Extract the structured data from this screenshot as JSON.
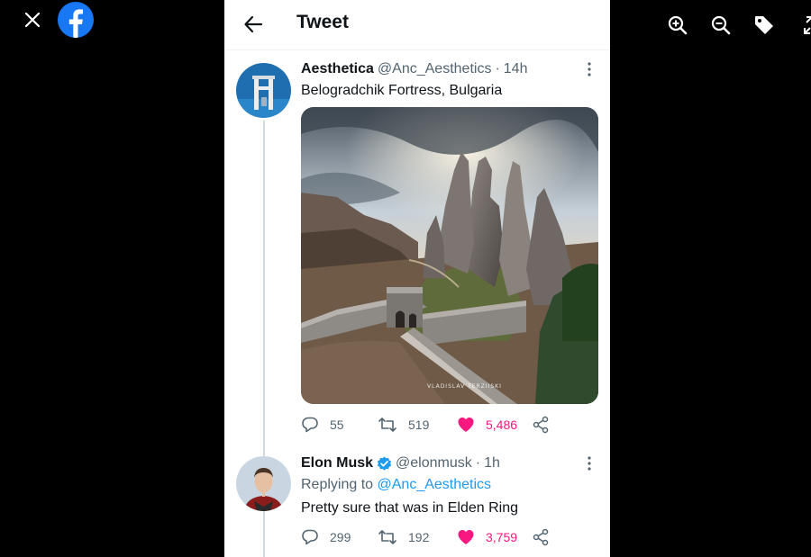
{
  "viewer": {
    "close_icon": "close-icon",
    "app_icon": "facebook-logo",
    "zoom_in_icon": "zoom-in-icon",
    "zoom_out_icon": "zoom-out-icon",
    "tag_icon": "tag-icon",
    "fullscreen_icon": "fullscreen-icon"
  },
  "header": {
    "title": "Tweet",
    "back_icon": "arrow-left-icon"
  },
  "tweets": [
    {
      "name": "Aesthetica",
      "handle": "@Anc_Aesthetics",
      "time": "14h",
      "text": "Belogradchik Fortress, Bulgaria",
      "image_watermark": "VLADISLAV TERZIISKI",
      "stats": {
        "replies": "55",
        "retweets": "519",
        "likes": "5,486"
      },
      "liked": true
    },
    {
      "name": "Elon Musk",
      "verified": true,
      "handle": "@elonmusk",
      "time": "1h",
      "replying_label": "Replying to",
      "replying_to": "@Anc_Aesthetics",
      "text": "Pretty sure that was in Elden Ring",
      "stats": {
        "replies": "299",
        "retweets": "192",
        "likes": "3,759"
      },
      "liked": true
    }
  ],
  "colors": {
    "accent": "#1d9bf0",
    "like": "#f91880",
    "secondary_text": "#536471",
    "facebook": "#1877f2"
  },
  "separator": "·"
}
